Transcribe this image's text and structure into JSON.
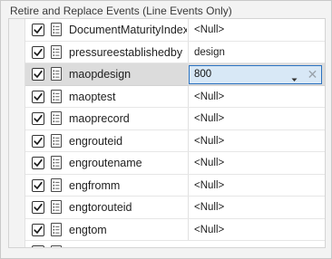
{
  "section": {
    "title": "Retire and Replace Events (Line Events Only)"
  },
  "fields": [
    {
      "name": "DocumentMaturityIndex",
      "value": "<Null>",
      "checked": true
    },
    {
      "name": "pressureestablishedby",
      "value": "design",
      "checked": true
    },
    {
      "name": "maopdesign",
      "value": "800",
      "checked": true,
      "selected": true,
      "editing": true
    },
    {
      "name": "maoptest",
      "value": "<Null>",
      "checked": true
    },
    {
      "name": "maoprecord",
      "value": "<Null>",
      "checked": true
    },
    {
      "name": "engrouteid",
      "value": "<Null>",
      "checked": true
    },
    {
      "name": "engroutename",
      "value": "<Null>",
      "checked": true
    },
    {
      "name": "engfromm",
      "value": "<Null>",
      "checked": true
    },
    {
      "name": "engtorouteid",
      "value": "<Null>",
      "checked": true
    },
    {
      "name": "engtom",
      "value": "<Null>",
      "checked": true
    }
  ],
  "editor": {
    "caret_icon": "chevron-down-icon",
    "clear_icon": "close-icon",
    "clear_glyph": "✕"
  },
  "colors": {
    "selected_row": "#dcdcdc",
    "editor_border": "#2b72c0",
    "editor_fill": "#d8e8f6"
  }
}
